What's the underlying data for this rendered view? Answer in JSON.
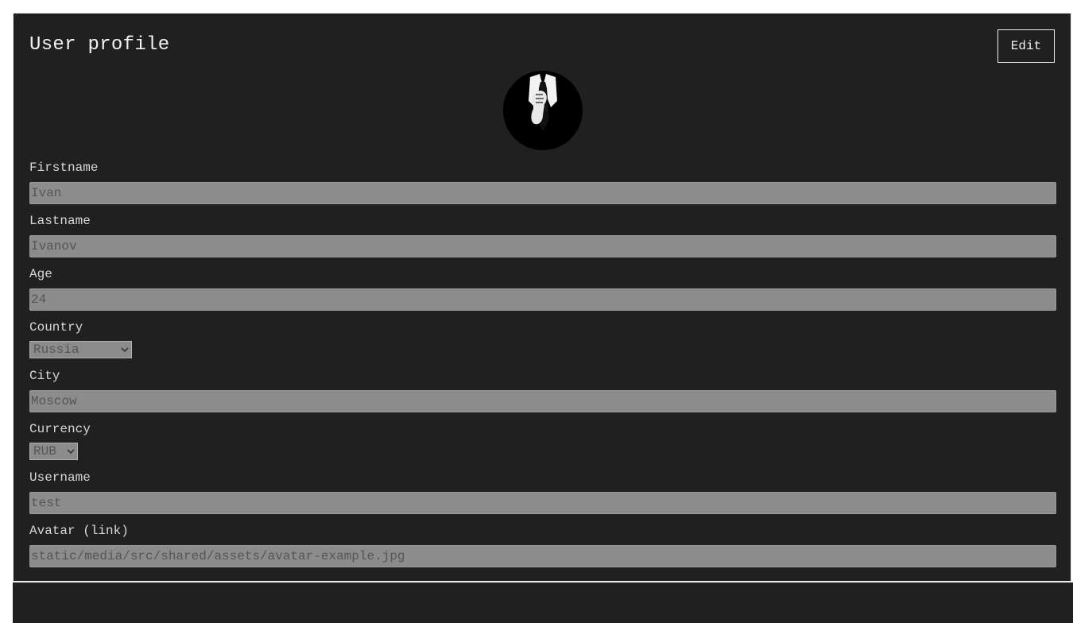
{
  "header": {
    "title": "User profile",
    "edit_label": "Edit"
  },
  "avatar": {
    "icon": "avatar-anonymous-suit-icon"
  },
  "fields": {
    "firstname": {
      "label": "Firstname",
      "value": "Ivan"
    },
    "lastname": {
      "label": "Lastname",
      "value": "Ivanov"
    },
    "age": {
      "label": "Age",
      "value": "24"
    },
    "country": {
      "label": "Country",
      "value": "Russia"
    },
    "city": {
      "label": "City",
      "value": "Moscow"
    },
    "currency": {
      "label": "Currency",
      "value": "RUB"
    },
    "username": {
      "label": "Username",
      "value": "test"
    },
    "avatar_link": {
      "label": "Avatar (link)",
      "value": "static/media/src/shared/assets/avatar-example.jpg"
    }
  },
  "colors": {
    "card_background": "#202020",
    "input_background": "#8c8c8c",
    "text": "#f2f2f2"
  }
}
